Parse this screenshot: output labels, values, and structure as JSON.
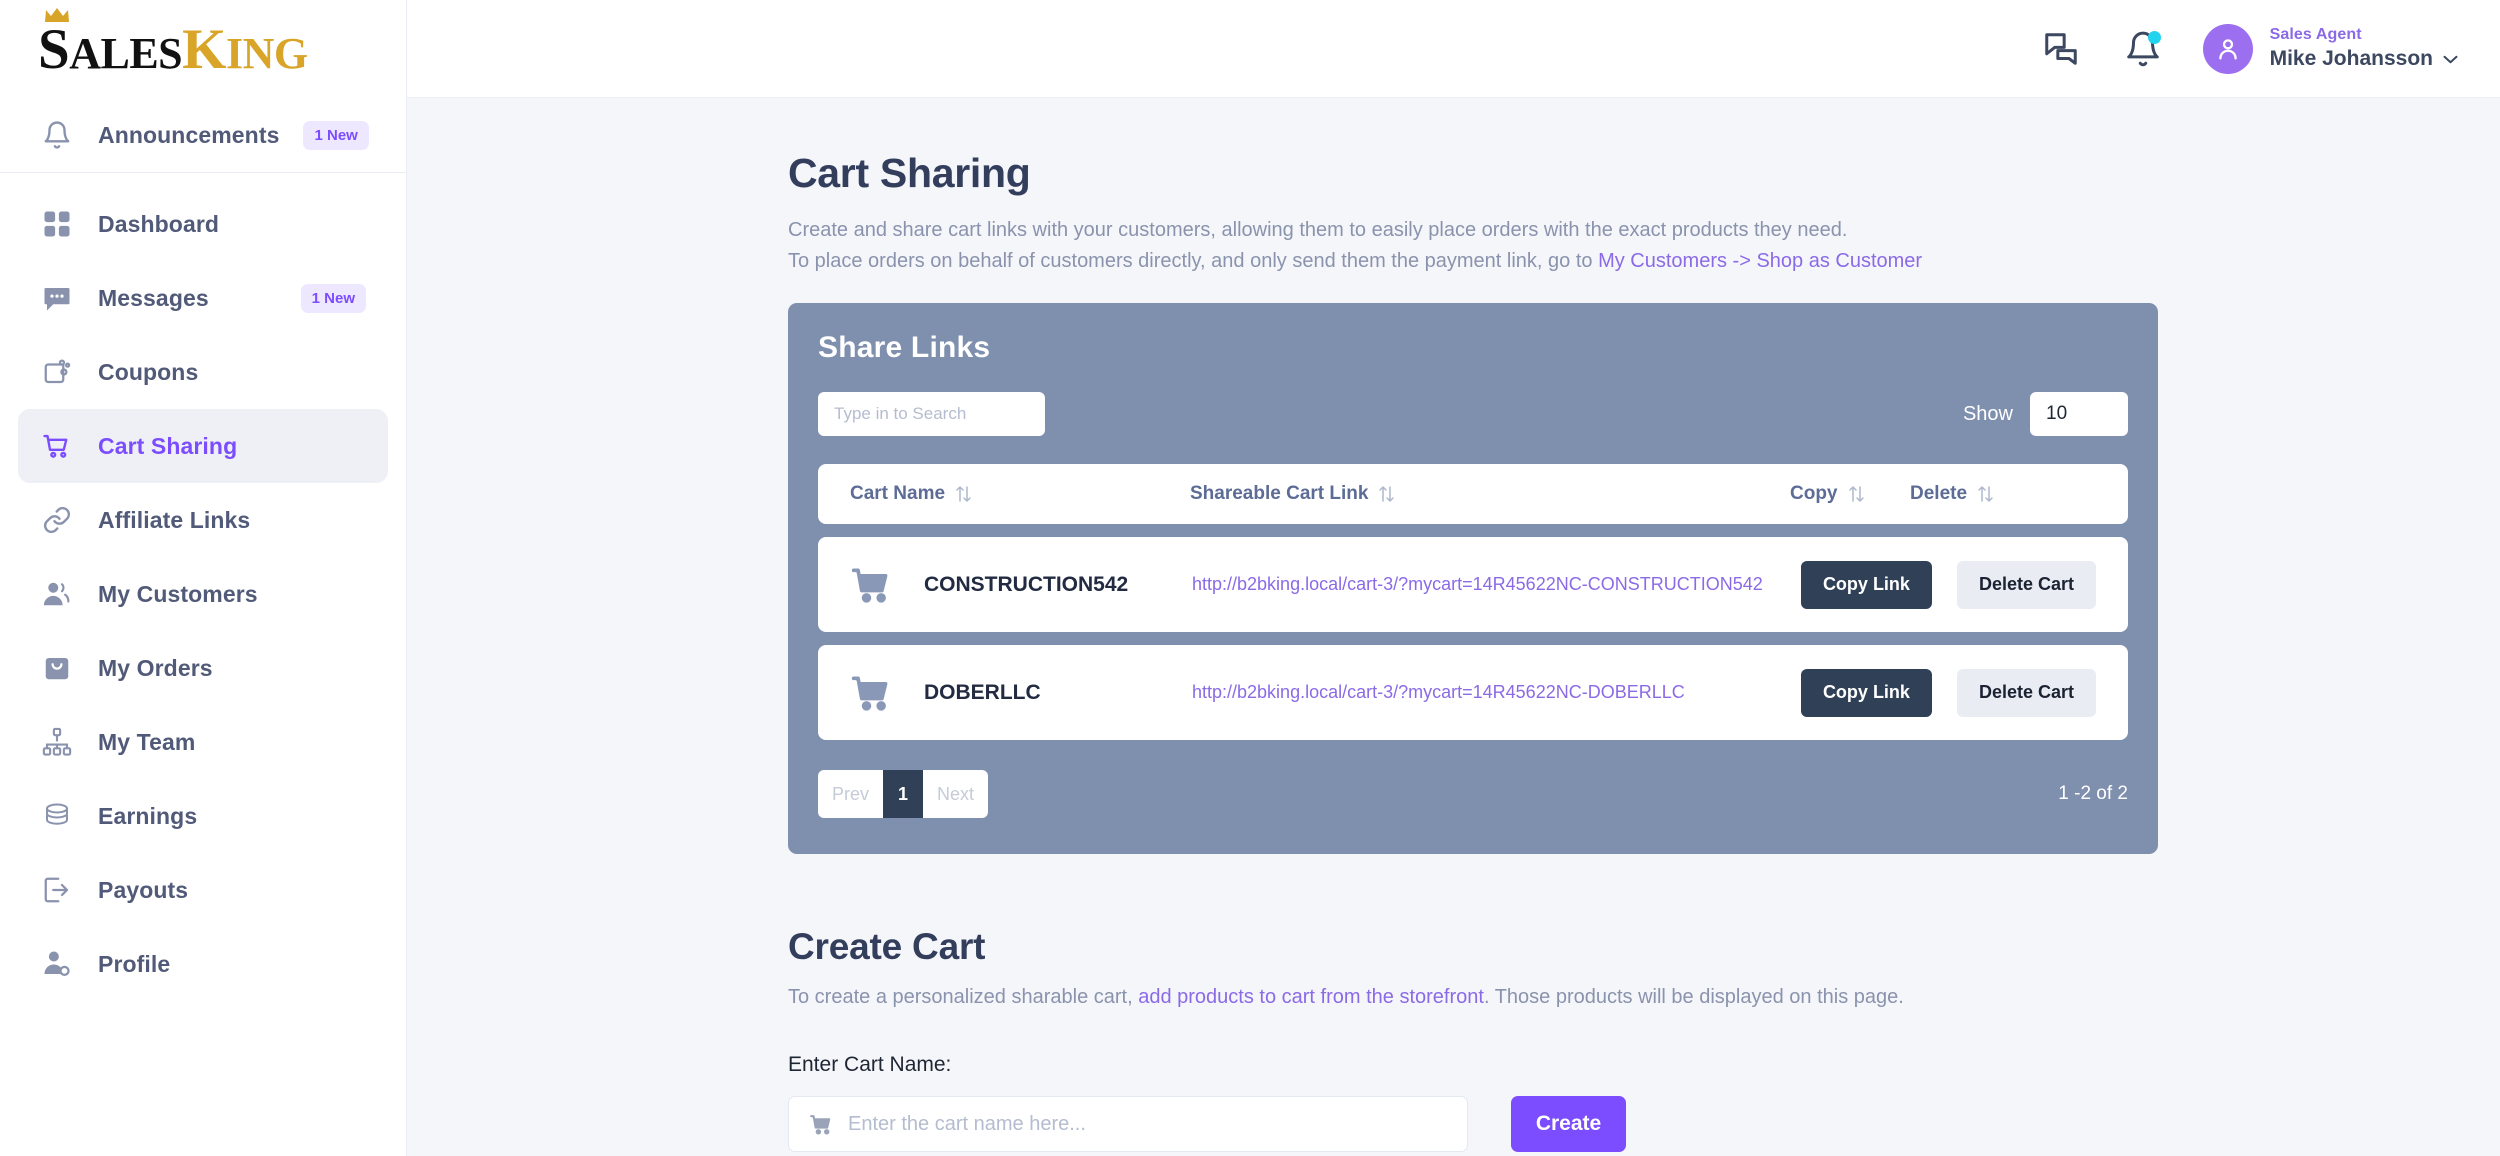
{
  "brand": {
    "name_part1": "S",
    "name_part1_rest": "ALES",
    "name_part2": "K",
    "name_part2_rest": "ING"
  },
  "colors": {
    "page_bg": "#f5f6fa",
    "card_bg": "#7f8fae",
    "accent_purple": "#7c4dff",
    "link_purple": "#8b6ae6",
    "dark_navy": "#2f4057",
    "badge_bg": "#ede8ff",
    "avatar_bg": "#9c6ef0",
    "bell_dot": "#22d3ee",
    "logo_gold": "#d9a528"
  },
  "sidebar": {
    "announcements": {
      "label": "Announcements",
      "badge": "1 New",
      "icon": "bell-icon"
    },
    "items": [
      {
        "label": "Dashboard",
        "icon": "grid-icon",
        "badge": "",
        "active": false
      },
      {
        "label": "Messages",
        "icon": "chat-icon",
        "badge": "1 New",
        "active": false
      },
      {
        "label": "Coupons",
        "icon": "wallet-icon",
        "badge": "",
        "active": false
      },
      {
        "label": "Cart Sharing",
        "icon": "cart-icon",
        "badge": "",
        "active": true
      },
      {
        "label": "Affiliate Links",
        "icon": "link-icon",
        "badge": "",
        "active": false
      },
      {
        "label": "My Customers",
        "icon": "users-icon",
        "badge": "",
        "active": false
      },
      {
        "label": "My Orders",
        "icon": "bag-icon",
        "badge": "",
        "active": false
      },
      {
        "label": "My Team",
        "icon": "hierarchy-icon",
        "badge": "",
        "active": false
      },
      {
        "label": "Earnings",
        "icon": "coins-icon",
        "badge": "",
        "active": false
      },
      {
        "label": "Payouts",
        "icon": "payout-icon",
        "badge": "",
        "active": false
      },
      {
        "label": "Profile",
        "icon": "profile-icon",
        "badge": "",
        "active": false
      }
    ]
  },
  "topbar": {
    "chat_icon": "chat-bubbles-icon",
    "bell_icon": "bell-icon",
    "user_role": "Sales Agent",
    "user_name": "Mike Johansson",
    "chevron": "chevron-down-icon"
  },
  "page": {
    "title": "Cart Sharing",
    "desc_line1": "Create and share cart links with your customers, allowing them to easily place orders with the exact products they need.",
    "desc_line2_prefix": "To place orders on behalf of customers directly, and only send them the payment link, go to ",
    "desc_line2_link": "My Customers -> Shop as Customer"
  },
  "share_links": {
    "card_title": "Share Links",
    "search_placeholder": "Type in to Search",
    "search_value": "",
    "show_label": "Show",
    "show_value": "10",
    "columns": [
      {
        "label": "Cart Name",
        "sortable": true
      },
      {
        "label": "Shareable Cart Link",
        "sortable": true
      },
      {
        "label": "Copy",
        "sortable": true
      },
      {
        "label": "Delete",
        "sortable": true
      }
    ],
    "rows": [
      {
        "icon": "cart-icon",
        "cart_name": "CONSTRUCTION542",
        "cart_link": "http://b2bking.local/cart-3/?mycart=14R45622NC-CONSTRUCTION542",
        "copy_label": "Copy Link",
        "delete_label": "Delete Cart"
      },
      {
        "icon": "cart-icon",
        "cart_name": "DOBERLLC",
        "cart_link": "http://b2bking.local/cart-3/?mycart=14R45622NC-DOBERLLC",
        "copy_label": "Copy Link",
        "delete_label": "Delete Cart"
      }
    ],
    "pagination": {
      "prev": "Prev",
      "pages": [
        "1"
      ],
      "current": "1",
      "next": "Next",
      "info": "1 -2 of 2"
    }
  },
  "create_cart": {
    "title": "Create Cart",
    "desc_prefix": "To create a personalized sharable cart, ",
    "desc_link": "add products to cart from the storefront",
    "desc_suffix": ". Those products will be displayed on this page.",
    "field_label": "Enter Cart Name:",
    "input_placeholder": "Enter the cart name here...",
    "input_value": "",
    "input_icon": "cart-icon",
    "create_button": "Create"
  }
}
